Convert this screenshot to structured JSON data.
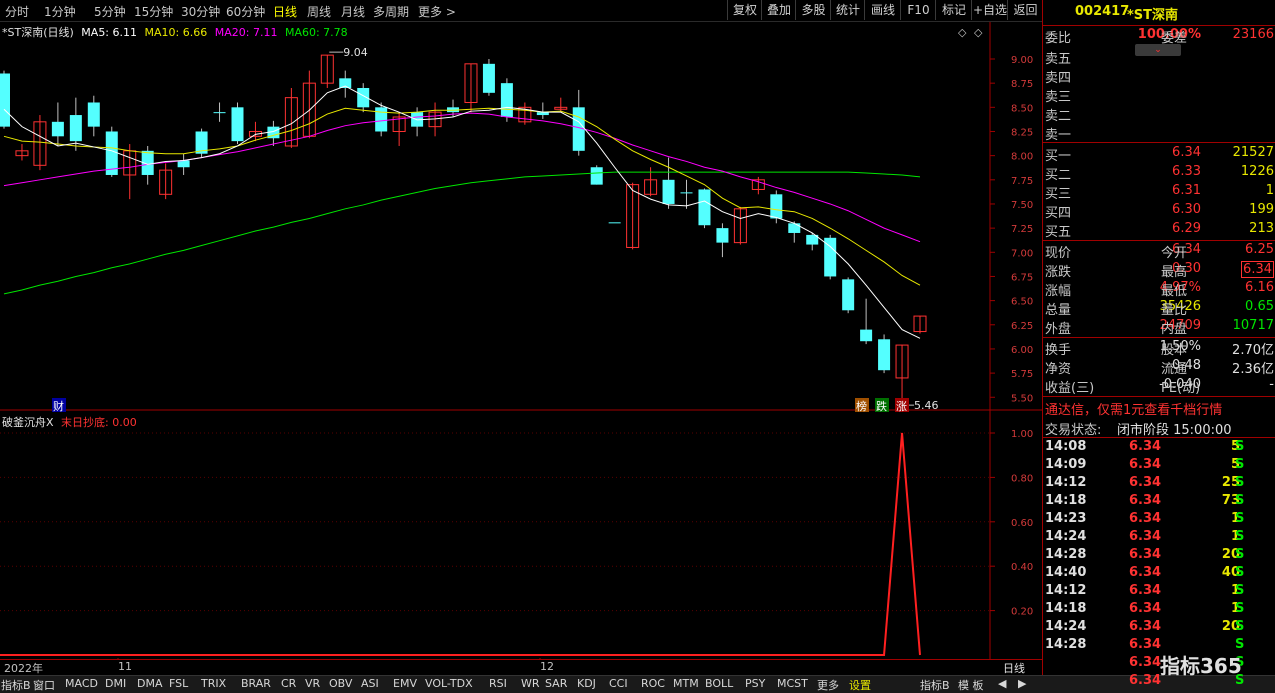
{
  "toolbar": {
    "periods": [
      "分时",
      "1分钟",
      "5分钟",
      "15分钟",
      "30分钟",
      "60分钟",
      "日线",
      "周线",
      "月线",
      "多周期",
      "更多 >"
    ],
    "active_period": "日线",
    "buttons": [
      "复权",
      "叠加",
      "多股",
      "统计",
      "画线",
      "F10",
      "标记",
      "+自选",
      "返回"
    ]
  },
  "legend": {
    "title": "*ST深南(日线)",
    "ma5": "MA5: 6.11",
    "ma10": "MA10: 6.66",
    "ma20": "MA20: 7.11",
    "ma60": "MA60: 7.78",
    "colors": {
      "ma5": "#ffffff",
      "ma10": "#e8e800",
      "ma20": "#ff00ff",
      "ma60": "#00e600"
    }
  },
  "markers": {
    "high": "9.04",
    "low": "5.46",
    "cai": "财",
    "bang": "榜",
    "die": "跌",
    "zhang": "涨"
  },
  "sub_chart": {
    "name": "破釜沉舟X",
    "series": "末日抄底: 0.00"
  },
  "dates": {
    "d1": "2022年",
    "d2": "11",
    "d3": "12",
    "period": "日线"
  },
  "indicators": [
    "指标B",
    "窗口",
    "MACD",
    "DMI",
    "DMA",
    "FSL",
    "TRIX",
    "BRAR",
    "CR",
    "VR",
    "OBV",
    "ASI",
    "EMV",
    "VOL-TDX",
    "RSI",
    "WR",
    "SAR",
    "KDJ",
    "CCI",
    "ROC",
    "MTM",
    "BOLL",
    "PSY",
    "MCST",
    "更多",
    "设置"
  ],
  "indicators_right": [
    "指标B",
    "模 板",
    "◀",
    "▶"
  ],
  "brand": "指标365",
  "chart_data": {
    "type": "candlestick",
    "y_ticks": [
      "9.00",
      "8.75",
      "8.50",
      "8.25",
      "8.00",
      "7.75",
      "7.50",
      "7.25",
      "7.00",
      "6.75",
      "6.50",
      "6.25",
      "6.00",
      "5.75",
      "5.50"
    ],
    "ylim": [
      5.42,
      9.3
    ],
    "sub_y_ticks": [
      "1.00",
      "0.80",
      "0.60",
      "0.40",
      "0.20"
    ],
    "candles": [
      [
        8.85,
        8.3,
        8.88,
        8.28
      ],
      [
        8.0,
        8.05,
        8.12,
        7.95
      ],
      [
        7.9,
        8.35,
        8.42,
        7.85
      ],
      [
        8.35,
        8.2,
        8.55,
        8.1
      ],
      [
        8.42,
        8.15,
        8.6,
        8.05
      ],
      [
        8.55,
        8.3,
        8.62,
        8.2
      ],
      [
        8.25,
        7.8,
        8.3,
        7.78
      ],
      [
        7.8,
        8.05,
        8.12,
        7.55
      ],
      [
        8.05,
        7.8,
        8.1,
        7.7
      ],
      [
        7.6,
        7.85,
        7.92,
        7.55
      ],
      [
        7.95,
        7.88,
        8.02,
        7.8
      ],
      [
        8.25,
        8.02,
        8.28,
        7.98
      ],
      [
        8.45,
        8.45,
        8.55,
        8.35
      ],
      [
        8.5,
        8.15,
        8.55,
        8.12
      ],
      [
        8.2,
        8.25,
        8.35,
        8.15
      ],
      [
        8.3,
        8.18,
        8.36,
        8.1
      ],
      [
        8.1,
        8.6,
        8.7,
        8.08
      ],
      [
        8.2,
        8.75,
        8.88,
        8.18
      ],
      [
        8.75,
        9.04,
        9.04,
        8.7
      ],
      [
        8.8,
        8.7,
        8.88,
        8.6
      ],
      [
        8.7,
        8.5,
        8.75,
        8.45
      ],
      [
        8.5,
        8.25,
        8.55,
        8.2
      ],
      [
        8.25,
        8.4,
        8.45,
        8.1
      ],
      [
        8.45,
        8.3,
        8.5,
        8.2
      ],
      [
        8.3,
        8.45,
        8.55,
        8.2
      ],
      [
        8.5,
        8.45,
        8.58,
        8.4
      ],
      [
        8.55,
        8.95,
        8.95,
        8.45
      ],
      [
        8.95,
        8.65,
        9.0,
        8.62
      ],
      [
        8.75,
        8.4,
        8.8,
        8.35
      ],
      [
        8.35,
        8.5,
        8.55,
        8.32
      ],
      [
        8.45,
        8.42,
        8.55,
        8.38
      ],
      [
        8.48,
        8.5,
        8.6,
        8.45
      ],
      [
        8.5,
        8.05,
        8.68,
        8.0
      ],
      [
        7.88,
        7.7,
        7.9,
        7.7
      ],
      [
        7.31,
        7.31,
        7.31,
        7.31
      ],
      [
        7.05,
        7.7,
        7.72,
        7.03
      ],
      [
        7.6,
        7.75,
        7.88,
        7.58
      ],
      [
        7.75,
        7.5,
        7.98,
        7.45
      ],
      [
        7.62,
        7.62,
        7.75,
        7.45
      ],
      [
        7.65,
        7.28,
        7.66,
        7.25
      ],
      [
        7.25,
        7.1,
        7.3,
        6.95
      ],
      [
        7.1,
        7.45,
        7.47,
        7.08
      ],
      [
        7.65,
        7.75,
        7.78,
        7.6
      ],
      [
        7.6,
        7.35,
        7.64,
        7.3
      ],
      [
        7.3,
        7.2,
        7.32,
        7.1
      ],
      [
        7.18,
        7.08,
        7.2,
        7.02
      ],
      [
        7.15,
        6.75,
        7.18,
        6.72
      ],
      [
        6.72,
        6.4,
        6.74,
        6.37
      ],
      [
        6.2,
        6.08,
        6.52,
        6.05
      ],
      [
        6.1,
        5.78,
        6.15,
        5.75
      ],
      [
        5.7,
        6.04,
        6.04,
        5.46
      ],
      [
        6.18,
        6.34,
        6.34,
        6.16
      ]
    ],
    "ma5": [
      8.48,
      8.3,
      8.2,
      8.1,
      8.13,
      8.09,
      8.05,
      7.98,
      7.91,
      7.94,
      7.95,
      7.98,
      8.02,
      8.1,
      8.22,
      8.25,
      8.33,
      8.47,
      8.65,
      8.72,
      8.62,
      8.52,
      8.45,
      8.37,
      8.38,
      8.4,
      8.46,
      8.47,
      8.5,
      8.48,
      8.45,
      8.45,
      8.35,
      8.13,
      7.88,
      7.64,
      7.55,
      7.49,
      7.48,
      7.53,
      7.42,
      7.35,
      7.4,
      7.36,
      7.3,
      7.2,
      7.06,
      6.88,
      6.66,
      6.43,
      6.2,
      6.11
    ],
    "ma10": [
      8.2,
      8.15,
      8.14,
      8.12,
      8.1,
      8.09,
      8.08,
      8.05,
      8.03,
      8.02,
      8.02,
      8.05,
      8.07,
      8.1,
      8.16,
      8.21,
      8.26,
      8.33,
      8.43,
      8.49,
      8.47,
      8.45,
      8.44,
      8.45,
      8.47,
      8.47,
      8.48,
      8.49,
      8.48,
      8.47,
      8.45,
      8.46,
      8.4,
      8.3,
      8.17,
      8.05,
      7.96,
      7.88,
      7.79,
      7.7,
      7.56,
      7.46,
      7.47,
      7.44,
      7.42,
      7.35,
      7.25,
      7.14,
      7.02,
      6.9,
      6.76,
      6.66
    ],
    "ma20": [
      7.69,
      7.72,
      7.75,
      7.78,
      7.81,
      7.84,
      7.86,
      7.88,
      7.91,
      7.93,
      7.95,
      7.98,
      8.01,
      8.04,
      8.08,
      8.12,
      8.16,
      8.2,
      8.26,
      8.31,
      8.34,
      8.36,
      8.38,
      8.4,
      8.41,
      8.43,
      8.44,
      8.43,
      8.4,
      8.38,
      8.36,
      8.33,
      8.29,
      8.24,
      8.18,
      8.11,
      8.05,
      7.99,
      7.94,
      7.88,
      7.84,
      7.78,
      7.73,
      7.67,
      7.62,
      7.56,
      7.5,
      7.43,
      7.34,
      7.25,
      7.18,
      7.11
    ],
    "ma60": [
      6.57,
      6.61,
      6.66,
      6.7,
      6.75,
      6.79,
      6.84,
      6.88,
      6.93,
      6.98,
      7.02,
      7.07,
      7.12,
      7.17,
      7.22,
      7.26,
      7.31,
      7.35,
      7.4,
      7.45,
      7.49,
      7.54,
      7.58,
      7.62,
      7.66,
      7.69,
      7.72,
      7.74,
      7.76,
      7.78,
      7.79,
      7.8,
      7.81,
      7.82,
      7.83,
      7.83,
      7.83,
      7.83,
      7.83,
      7.83,
      7.83,
      7.83,
      7.83,
      7.83,
      7.83,
      7.83,
      7.83,
      7.83,
      7.82,
      7.81,
      7.8,
      7.78
    ],
    "sub_values_visible": "0 everywhere except spike to 1.00 at the second-to-last bar"
  },
  "panel": {
    "code": "002417",
    "name": "*ST深南",
    "weibi_label": "委比",
    "weibi": "100.00%",
    "weicha_label": "委差",
    "weicha": "23166",
    "sells": [
      {
        "l": "卖五"
      },
      {
        "l": "卖四"
      },
      {
        "l": "卖三"
      },
      {
        "l": "卖二"
      },
      {
        "l": "卖一"
      }
    ],
    "buys": [
      {
        "l": "买一",
        "p": "6.34",
        "v": "21527"
      },
      {
        "l": "买二",
        "p": "6.33",
        "v": "1226"
      },
      {
        "l": "买三",
        "p": "6.31",
        "v": "1"
      },
      {
        "l": "买四",
        "p": "6.30",
        "v": "199"
      },
      {
        "l": "买五",
        "p": "6.29",
        "v": "213"
      }
    ],
    "stats": [
      {
        "l1": "现价",
        "v1": "6.34",
        "c1": "red",
        "l2": "今开",
        "v2": "6.25",
        "c2": "red"
      },
      {
        "l1": "涨跌",
        "v1": "0.30",
        "c1": "red",
        "l2": "最高",
        "v2": "6.34",
        "c2": "red"
      },
      {
        "l1": "涨幅",
        "v1": "4.97%",
        "c1": "red",
        "l2": "最低",
        "v2": "6.16",
        "c2": "red"
      },
      {
        "l1": "总量",
        "v1": "35426",
        "c1": "yellow",
        "l2": "量比",
        "v2": "0.65",
        "c2": "green"
      },
      {
        "l1": "外盘",
        "v1": "24709",
        "c1": "red",
        "l2": "内盘",
        "v2": "10717",
        "c2": "green"
      }
    ],
    "stats2": [
      {
        "l1": "换手",
        "v1": "1.50%",
        "l2": "股本",
        "v2": "2.70亿"
      },
      {
        "l1": "净资",
        "v1": "0.48",
        "l2": "流通",
        "v2": "2.36亿"
      },
      {
        "l1": "收益(三)",
        "v1": "-0.040",
        "l2": "PE(动)",
        "v2": "-"
      }
    ],
    "ad": "通达信，仅需1元查看千档行情",
    "status_label": "交易状态:",
    "status": "闭市阶段 15:00:00",
    "ticks": [
      {
        "t": "14:08",
        "p": "6.34",
        "v": "5",
        "s": "S"
      },
      {
        "t": "14:09",
        "p": "6.34",
        "v": "5",
        "s": "S"
      },
      {
        "t": "14:12",
        "p": "6.34",
        "v": "25",
        "s": "S"
      },
      {
        "t": "14:18",
        "p": "6.34",
        "v": "73",
        "s": "S"
      },
      {
        "t": "14:23",
        "p": "6.34",
        "v": "1",
        "s": "S"
      },
      {
        "t": "14:24",
        "p": "6.34",
        "v": "1",
        "s": "S"
      },
      {
        "t": "14:28",
        "p": "6.34",
        "v": "20",
        "s": "S"
      },
      {
        "t": "14:40",
        "p": "6.34",
        "v": "40",
        "s": "S"
      },
      {
        "t": "14:12",
        "p": "6.34",
        "v": "1",
        "s": "S"
      },
      {
        "t": "14:18",
        "p": "6.34",
        "v": "1",
        "s": "S"
      },
      {
        "t": "14:24",
        "p": "6.34",
        "v": "20",
        "s": "S"
      },
      {
        "t": "14:28",
        "p": "6.34",
        "v": "",
        "s": "S"
      },
      {
        "t": "",
        "p": "6.34",
        "v": "",
        "s": "S"
      },
      {
        "t": "",
        "p": "6.34",
        "v": "",
        "s": "S"
      }
    ]
  }
}
